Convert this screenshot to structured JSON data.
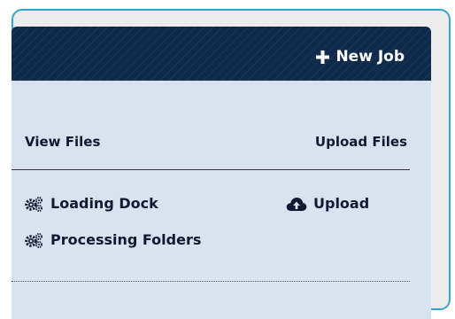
{
  "header": {
    "new_job_label": "New Job",
    "plus_icon": "plus-icon"
  },
  "columns": {
    "view_files": {
      "heading": "View Files",
      "items": [
        {
          "label": "Loading Dock",
          "icon": "gears-icon"
        },
        {
          "label": "Processing Folders",
          "icon": "gears-icon"
        }
      ]
    },
    "upload_files": {
      "heading": "Upload Files",
      "items": [
        {
          "label": "Upload",
          "icon": "cloud-upload-icon"
        }
      ]
    }
  },
  "colors": {
    "frame_border": "#3aa3c9",
    "header_bg": "#0f2a4b",
    "panel_bg": "#d7e3ef",
    "text": "#121a33"
  }
}
